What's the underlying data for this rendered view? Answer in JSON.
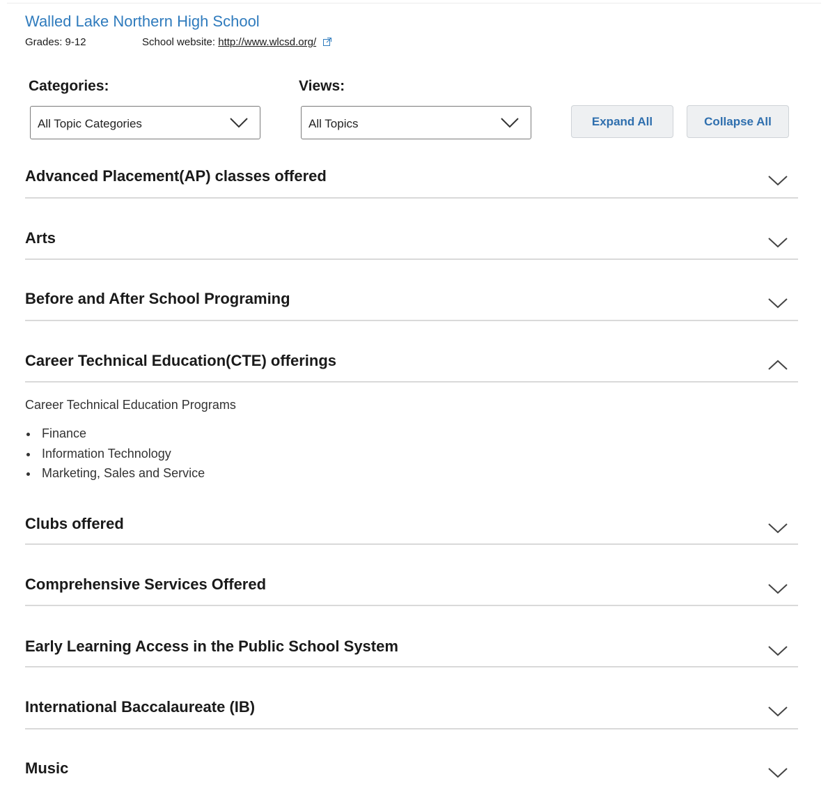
{
  "school": {
    "name": "Walled Lake Northern High School",
    "grades": "Grades: 9-12",
    "website_label": "School website:",
    "website_url": "http://www.wlcsd.org/"
  },
  "filters": {
    "categories_label": "Categories:",
    "categories_value": "All Topic Categories",
    "views_label": "Views:",
    "views_value": "All Topics",
    "expand_all": "Expand All",
    "collapse_all": "Collapse All"
  },
  "sections": [
    {
      "title": "Advanced Placement(AP) classes offered",
      "expanded": false
    },
    {
      "title": "Arts",
      "expanded": false
    },
    {
      "title": "Before and After School Programing",
      "expanded": false
    },
    {
      "title": "Career Technical Education(CTE) offerings",
      "expanded": true
    },
    {
      "title": "Clubs offered",
      "expanded": false
    },
    {
      "title": "Comprehensive Services Offered",
      "expanded": false
    },
    {
      "title": "Early Learning Access in the Public School System",
      "expanded": false
    },
    {
      "title": "International Baccalaureate (IB)",
      "expanded": false
    },
    {
      "title": "Music",
      "expanded": false
    }
  ],
  "cte": {
    "heading": "Career Technical Education Programs",
    "programs": [
      "Finance",
      "Information Technology",
      "Marketing, Sales and Service"
    ]
  },
  "colors": {
    "link_blue": "#2f7bbd",
    "button_text": "#2f6fae",
    "button_bg": "#eef0f2",
    "rule": "#d9d9d9"
  },
  "icons": {
    "external_link": "external-link-icon",
    "dropdown": "chevron-down-icon",
    "collapsed": "chevron-down-icon",
    "expanded": "chevron-up-icon"
  }
}
